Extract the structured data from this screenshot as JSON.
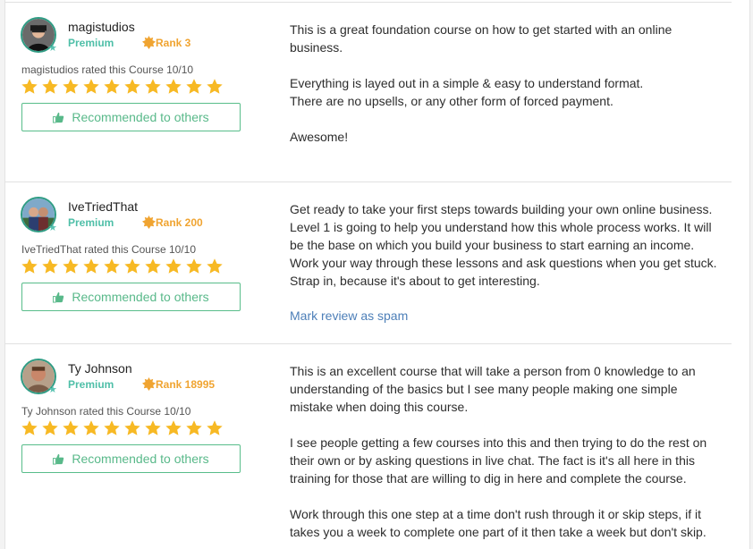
{
  "reviews": [
    {
      "username": "magistudios",
      "membership": "Premium",
      "rank": "Rank 3",
      "rating_text": "magistudios rated this Course 10/10",
      "stars": 10,
      "recommend_label": "Recommended to others",
      "paragraphs": [
        "This is a great foundation course on how to get started with an online business.",
        "Everything is layed out in a simple & easy to understand format.\nThere are no upsells, or any other form of forced payment.",
        "Awesome!"
      ]
    },
    {
      "username": "IveTriedThat",
      "membership": "Premium",
      "rank": "Rank 200",
      "rating_text": "IveTriedThat rated this Course 10/10",
      "stars": 10,
      "recommend_label": "Recommended to others",
      "paragraphs": [
        "Get ready to take your first steps towards building your own online business. Level 1 is going to help you understand how this whole process works. It will be the base on which you build your business to start earning an income. Work your way through these lessons and ask questions when you get stuck. Strap in, because it's about to get interesting."
      ],
      "spam_link": "Mark review as spam"
    },
    {
      "username": "Ty Johnson",
      "membership": "Premium",
      "rank": "Rank 18995",
      "rating_text": "Ty Johnson rated this Course 10/10",
      "stars": 10,
      "recommend_label": "Recommended to others",
      "paragraphs": [
        "This is an excellent course that will take a person from 0 knowledge to an understanding of the basics but I see many people making one simple mistake when doing this course.",
        "I see people getting a few courses into this and then trying to do the rest on their own or by asking questions in live chat. The fact is it's all here in this training for those that are willing to dig in here and complete the course.",
        "Work through this one step at a time don't rush through it or skip steps, if it takes you a week to complete one part of it then take a week but don't skip."
      ]
    }
  ],
  "colors": {
    "premium": "#4fbfa8",
    "rank": "#f0a431",
    "star": "#f7b924",
    "recommend": "#59b98a",
    "link": "#4d7fb8"
  },
  "icons": {
    "avatar": "user-avatar",
    "rank": "rank-badge-icon",
    "star": "star-icon",
    "thumb": "thumbs-up-icon",
    "premium": "premium-star-icon"
  }
}
